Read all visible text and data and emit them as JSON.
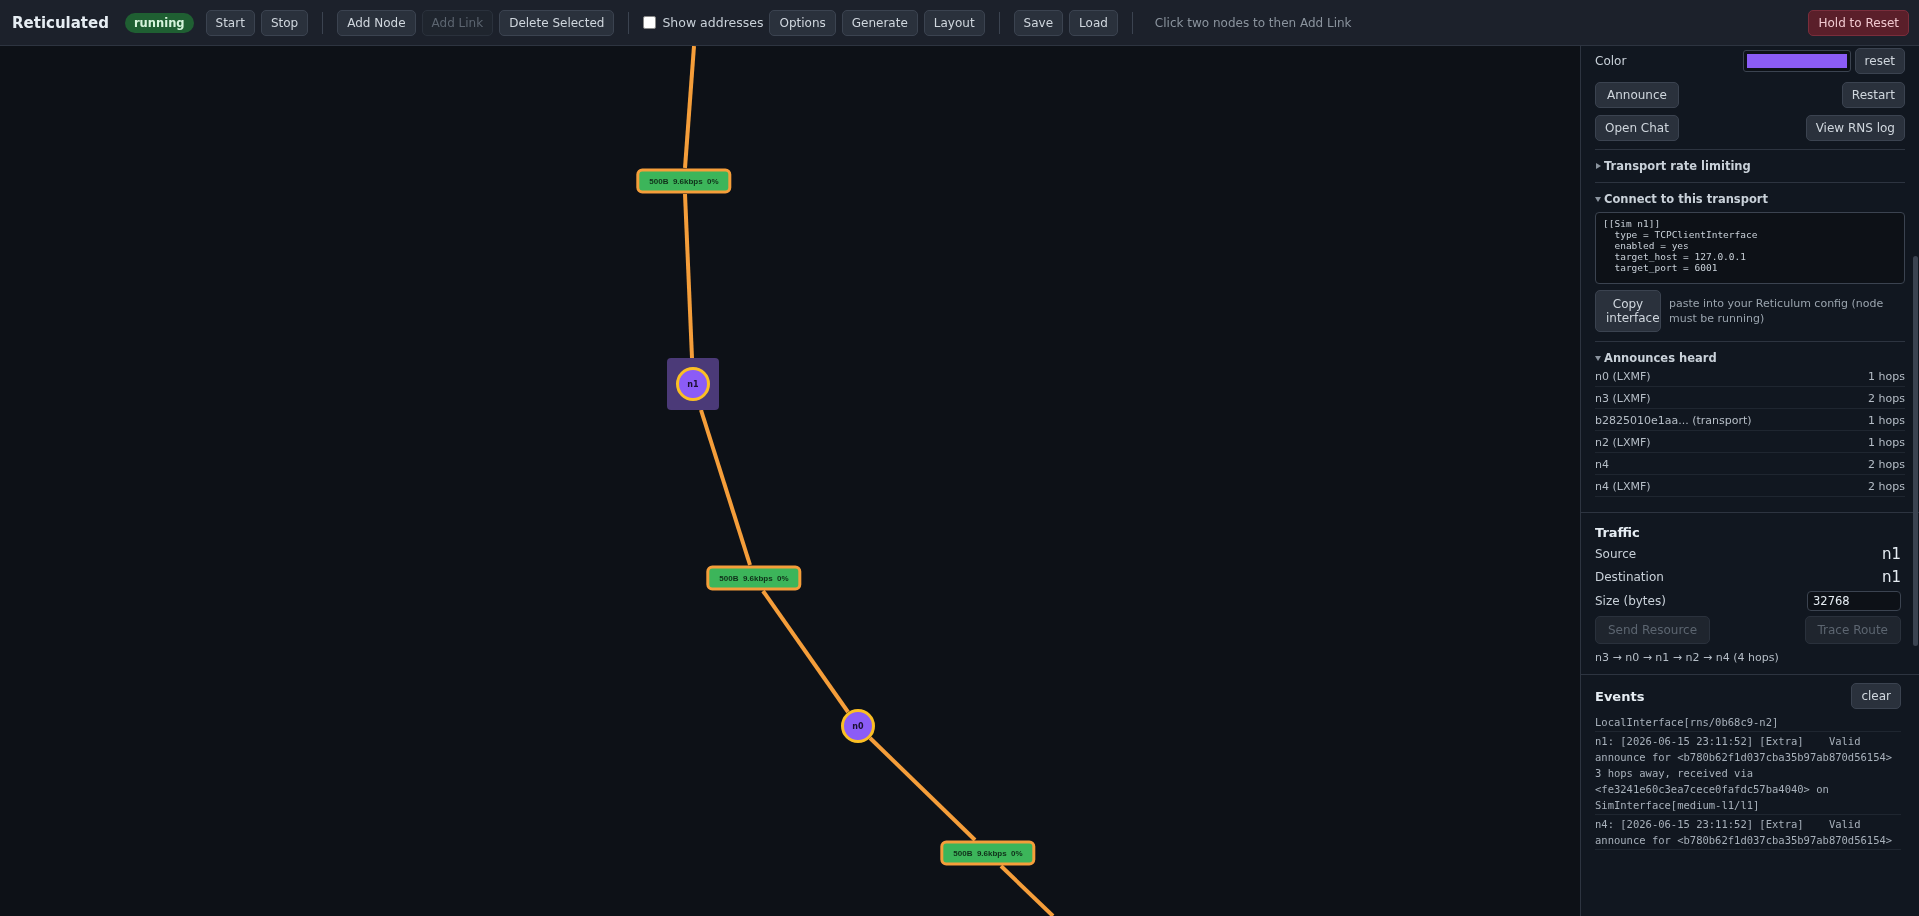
{
  "toolbar": {
    "title": "Reticulated",
    "status": {
      "label": "running",
      "kind": "running"
    },
    "groups": [
      [
        {
          "kind": "button",
          "label": "Start",
          "disabled": false
        },
        {
          "kind": "button",
          "label": "Stop",
          "disabled": false
        }
      ],
      [
        {
          "kind": "button",
          "label": "Add Node",
          "disabled": false
        },
        {
          "kind": "button",
          "label": "Add Link",
          "disabled": true
        },
        {
          "kind": "button",
          "label": "Delete Selected",
          "disabled": false
        }
      ],
      [
        {
          "kind": "checkbox",
          "label": "Show addresses",
          "checked": false
        },
        {
          "kind": "button",
          "label": "Options",
          "disabled": false
        },
        {
          "kind": "button",
          "label": "Generate",
          "disabled": false
        },
        {
          "kind": "button",
          "label": "Layout",
          "disabled": false
        }
      ],
      [
        {
          "kind": "button",
          "label": "Save",
          "disabled": false
        },
        {
          "kind": "button",
          "label": "Load",
          "disabled": false
        }
      ]
    ],
    "hint": "Click two nodes to then Add Link",
    "reset_button": "Hold to Reset"
  },
  "canvas": {
    "links": [
      {
        "label": "500B  9.6kbps  0%"
      },
      {
        "label": "500B  9.6kbps  0%"
      },
      {
        "label": "500B  9.6kbps  0%"
      }
    ],
    "nodes": [
      {
        "label": "n1",
        "selected": true
      },
      {
        "label": "n0",
        "selected": false
      }
    ]
  },
  "node_panel": {
    "color_label": "Color",
    "reset_button": "reset",
    "actions": [
      {
        "label": "Announce",
        "disabled": false
      },
      {
        "label": "Restart",
        "disabled": false
      },
      {
        "label": "Open Chat",
        "disabled": false
      },
      {
        "label": "View RNS log",
        "disabled": false
      }
    ],
    "rate_limiting": {
      "title": "Transport rate limiting",
      "expanded": false
    },
    "connect": {
      "title": "Connect to this transport",
      "expanded": true,
      "config": "[[Sim n1]]\n  type = TCPClientInterface\n  enabled = yes\n  target_host = 127.0.0.1\n  target_port = 6001",
      "copy_button": "Copy interface",
      "note": "paste into your Reticulum config (node must be running)"
    },
    "announces": {
      "title": "Announces heard",
      "expanded": true,
      "rows": [
        {
          "name": "n0 (LXMF)",
          "hops": "1 hops"
        },
        {
          "name": "n3 (LXMF)",
          "hops": "2 hops"
        },
        {
          "name": "b2825010e1aa... (transport)",
          "hops": "1 hops"
        },
        {
          "name": "n2 (LXMF)",
          "hops": "1 hops"
        },
        {
          "name": "n4",
          "hops": "2 hops"
        },
        {
          "name": "n4 (LXMF)",
          "hops": "2 hops"
        }
      ]
    }
  },
  "traffic": {
    "title": "Traffic",
    "source_label": "Source",
    "source": "n1",
    "destination_label": "Destination",
    "destination": "n1",
    "size_label": "Size (bytes)",
    "size": "32768",
    "buttons": [
      {
        "label": "Send Resource",
        "disabled": true
      },
      {
        "label": "Trace Route",
        "disabled": true
      }
    ],
    "route": "n3 → n0 → n1 → n2 → n4 (4 hops)"
  },
  "events": {
    "title": "Events",
    "clear_button": "clear",
    "entries": [
      "LocalInterface[rns/0b68c9-n2]",
      "n1: [2026-06-15 23:11:52] [Extra]    Valid announce for <b780b62f1d037cba35b97ab870d56154> 3 hops away, received via <fe3241e60c3ea7cece0fafdc57ba4040> on SimInterface[medium-l1/l1]",
      "n4: [2026-06-15 23:11:52] [Extra]    Valid announce for <b780b62f1d037cba35b97ab870d56154>"
    ]
  }
}
